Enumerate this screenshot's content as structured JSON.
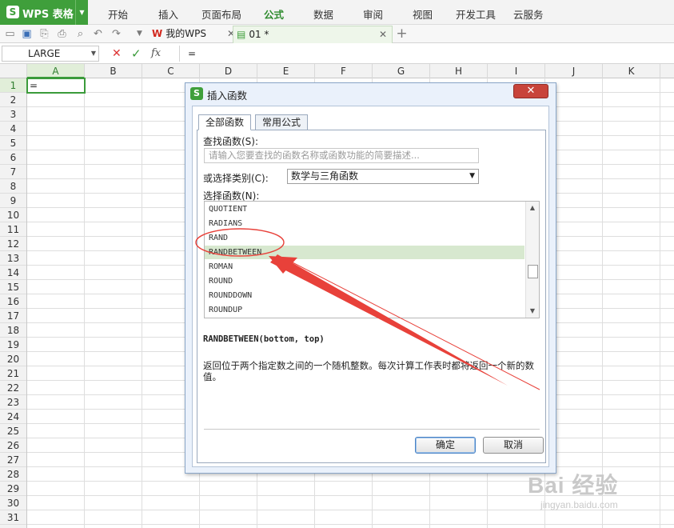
{
  "app": {
    "name": "WPS 表格",
    "logo_letter": "S"
  },
  "menu": [
    "开始",
    "插入",
    "页面布局",
    "公式",
    "数据",
    "审阅",
    "视图",
    "开发工具",
    "云服务"
  ],
  "menu_active": "公式",
  "tabs": {
    "mywps": "我的WPS",
    "doc": "01 *"
  },
  "formula_bar": {
    "name_box": "LARGE",
    "fx": "fx",
    "content": "="
  },
  "columns": [
    "A",
    "B",
    "C",
    "D",
    "E",
    "F",
    "G",
    "H",
    "I",
    "J",
    "K"
  ],
  "rows": [
    "1",
    "2",
    "3",
    "4",
    "5",
    "6",
    "7",
    "8",
    "9",
    "10",
    "11",
    "12",
    "13",
    "14",
    "15",
    "16",
    "17",
    "18",
    "19",
    "20",
    "21",
    "22",
    "23",
    "24",
    "25",
    "26",
    "27",
    "28",
    "29",
    "30",
    "31"
  ],
  "active_cell_value": "=",
  "dialog": {
    "title": "插入函数",
    "tab_all": "全部函数",
    "tab_common": "常用公式",
    "search_label": "查找函数(S):",
    "search_placeholder": "请输入您要查找的函数名称或函数功能的简要描述...",
    "category_label": "或选择类别(C):",
    "category_value": "数学与三角函数",
    "select_label": "选择函数(N):",
    "functions": [
      "QUOTIENT",
      "RADIANS",
      "RAND",
      "RANDBETWEEN",
      "ROMAN",
      "ROUND",
      "ROUNDDOWN",
      "ROUNDUP"
    ],
    "selected_function": "RANDBETWEEN",
    "signature": "RANDBETWEEN(bottom, top)",
    "description": "返回位于两个指定数之间的一个随机整数。每次计算工作表时都将返回一个新的数值。",
    "ok": "确定",
    "cancel": "取消"
  },
  "watermark": {
    "main": "Bai 经验",
    "sub": "jingyan.baidu.com"
  },
  "colors": {
    "accent": "#3f9f3b",
    "annotation": "#e8413a",
    "selection": "#d7e8cf"
  }
}
